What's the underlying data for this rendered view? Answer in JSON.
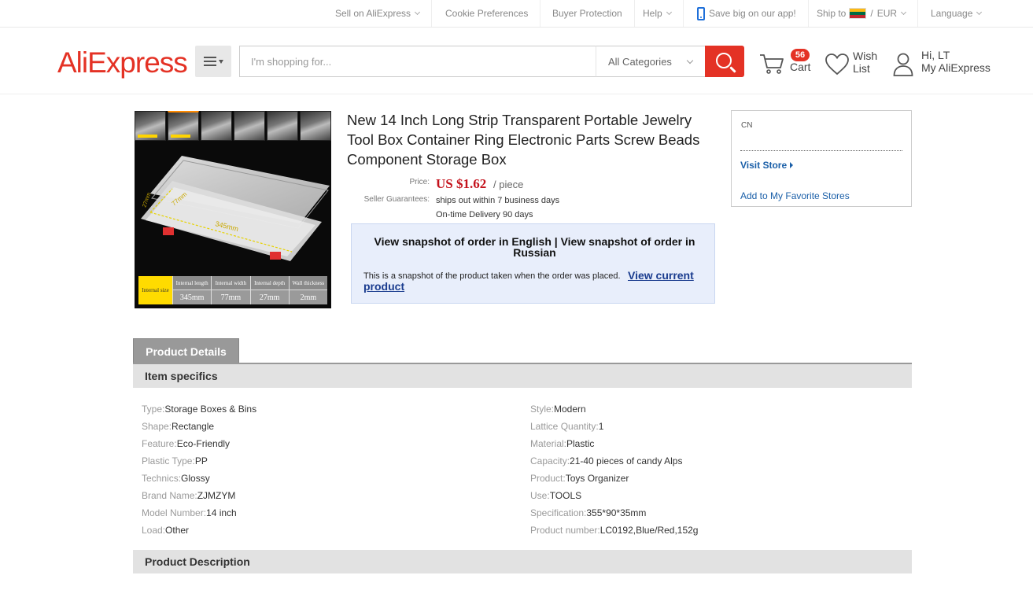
{
  "topbar": {
    "sell": "Sell on AliExpress",
    "cookie": "Cookie Preferences",
    "buyer": "Buyer Protection",
    "help": "Help",
    "app": "Save big on our app!",
    "ship_to": "Ship to",
    "currency_sep": "/",
    "currency": "EUR",
    "language": "Language"
  },
  "header": {
    "logo": "AliExpress",
    "search_placeholder": "I'm shopping for...",
    "category": "All Categories",
    "cart_count": "56",
    "cart_label": "Cart",
    "wish_label": "Wish List",
    "greeting": "Hi, LT",
    "my_account": "My AliExpress"
  },
  "gallery": {
    "thumb_count": 6,
    "spec_head": "Internal size",
    "spec_cols": [
      {
        "h": "Internal length",
        "v": "345mm"
      },
      {
        "h": "Internal width",
        "v": "77mm"
      },
      {
        "h": "Internal depth",
        "v": "27mm"
      },
      {
        "h": "Wall thickness",
        "v": "2mm"
      }
    ],
    "dim_length": "345mm",
    "dim_width": "77mm",
    "dim_depth": "27mm"
  },
  "product": {
    "title": "New 14 Inch Long Strip Transparent Portable Jewelry Tool Box Container Ring Electronic Parts Screw Beads Component Storage Box",
    "price_label": "Price:",
    "price": "US $1.62",
    "price_unit": "/ piece",
    "guarantee_label": "Seller Guarantees:",
    "guarantee_1": "ships out within 7 business days",
    "guarantee_2": "On-time Delivery 90 days"
  },
  "snapshot": {
    "heading": "View snapshot of order in English | View snapshot of order in Russian",
    "note": "This is a snapshot of the product taken when the order was placed.",
    "link": "View current product"
  },
  "store": {
    "country": "CN",
    "visit": "Visit Store",
    "favorite": "Add to My Favorite Stores"
  },
  "details": {
    "tab": "Product Details",
    "item_specifics": "Item specifics",
    "description": "Product Description",
    "left": [
      {
        "k": "Type:",
        "v": "Storage Boxes & Bins"
      },
      {
        "k": "Shape:",
        "v": "Rectangle"
      },
      {
        "k": "Feature:",
        "v": "Eco-Friendly"
      },
      {
        "k": "Plastic Type:",
        "v": "PP"
      },
      {
        "k": "Technics:",
        "v": "Glossy"
      },
      {
        "k": "Brand Name:",
        "v": "ZJMZYM"
      },
      {
        "k": "Model Number:",
        "v": "14 inch"
      },
      {
        "k": "Load:",
        "v": "Other"
      }
    ],
    "right": [
      {
        "k": "Style:",
        "v": "Modern"
      },
      {
        "k": "Lattice Quantity:",
        "v": "1"
      },
      {
        "k": "Material:",
        "v": "Plastic"
      },
      {
        "k": "Capacity:",
        "v": "21-40 pieces of candy Alps"
      },
      {
        "k": "Product:",
        "v": "Toys Organizer"
      },
      {
        "k": "Use:",
        "v": "TOOLS"
      },
      {
        "k": "Specification:",
        "v": "355*90*35mm"
      },
      {
        "k": "Product number:",
        "v": "LC0192,Blue/Red,152g"
      }
    ]
  },
  "colors": {
    "brand": "#e43225",
    "link": "#1a5fa8",
    "price": "#c4121c"
  }
}
